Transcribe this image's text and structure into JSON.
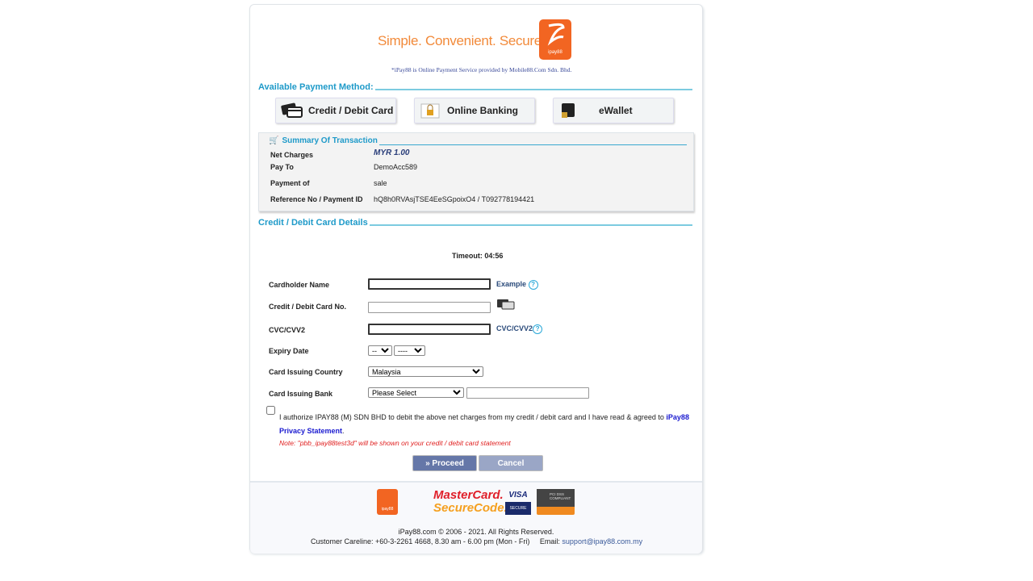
{
  "header": {
    "tagline": "Simple. Convenient. Secure.",
    "logo_text": "ipay88",
    "provided_by": "*iPay88 is Online Payment Service provided by Mobile88.Com Sdn. Bhd."
  },
  "payment_methods": {
    "title": "Available Payment Method:",
    "items": [
      {
        "label": "Credit / Debit Card",
        "icon": "credit-card-icon"
      },
      {
        "label": "Online Banking",
        "icon": "lock-icon"
      },
      {
        "label": "eWallet",
        "icon": "wallet-icon"
      }
    ]
  },
  "summary": {
    "title": "Summary Of Transaction",
    "rows": [
      {
        "label": "Net Charges",
        "value": "MYR 1.00"
      },
      {
        "label": "Pay To",
        "value": "DemoAcc589"
      },
      {
        "label": "Payment of",
        "value": "sale"
      },
      {
        "label": "Reference No / Payment ID",
        "value": "hQ8h0RVAsjTSE4EeSGpoixO4 / T092778194421"
      }
    ]
  },
  "card_details": {
    "title": "Credit / Debit Card Details",
    "timeout": "Timeout: 04:56",
    "cardholder_label": "Cardholder Name",
    "example_link": "Example",
    "card_no_label": "Credit / Debit Card No.",
    "cvc_label": "CVC/CVV2",
    "cvc_link": "CVC/CVV2",
    "expiry_label": "Expiry Date",
    "expiry_month": "--",
    "expiry_year": "----",
    "country_label": "Card Issuing Country",
    "country": "Malaysia",
    "bank_label": "Card Issuing Bank",
    "bank": "Please Select",
    "authorize_text": "I authorize IPAY88 (M) SDN BHD to debit the above net charges from my credit / debit card and I have read & agreed to ",
    "privacy_link": "iPay88 Privacy Statement",
    "note": "Note: \"pbb_ipay88test3d\" will be shown on your credit / debit card statement",
    "proceed": "» Proceed",
    "cancel": "Cancel"
  },
  "footer": {
    "mastercard": "MasterCard.",
    "securecode": "SecureCode.",
    "visa": "VISA",
    "visa_secure": "SECURE",
    "pci": "PCI DSS COMPLIANT",
    "copyright": "iPay88.com © 2006 - 2021. All Rights Reserved.",
    "careline": "Customer Careline: +60-3-2261 4668, 8.30 am - 6.00 pm (Mon - Fri)",
    "email_label": "Email:",
    "email": "support@ipay88.com.my"
  },
  "colors": {
    "accent": "#1e9ac9",
    "brand": "#f26522",
    "proceed": "#6577a8",
    "cancel": "#9aa6c6",
    "note": "#e02020"
  }
}
